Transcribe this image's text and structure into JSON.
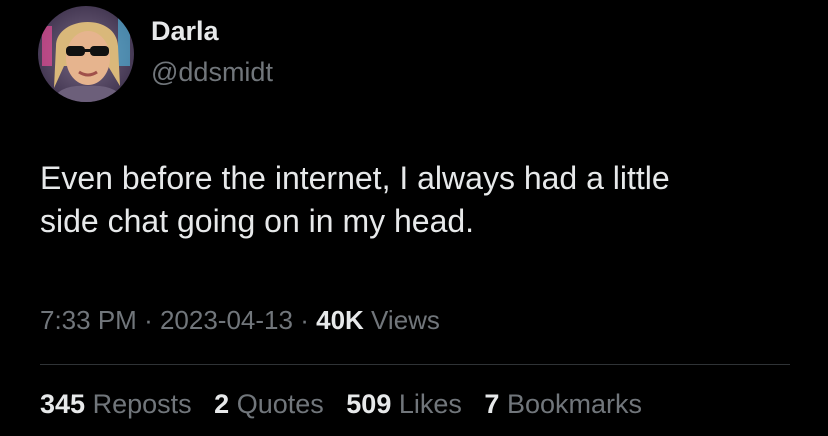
{
  "user": {
    "display_name": "Darla",
    "handle": "@ddsmidt",
    "avatar_icon": "profile-photo"
  },
  "tweet": {
    "lines": [
      "Even before the internet, I always had a little",
      "side chat going on in my head."
    ]
  },
  "meta": {
    "time": "7:33 PM",
    "separator": "·",
    "date": "2023-04-13",
    "views_count": "40K",
    "views_label": "Views"
  },
  "stats": {
    "reposts_count": "345",
    "reposts_label": "Reposts",
    "quotes_count": "2",
    "quotes_label": "Quotes",
    "likes_count": "509",
    "likes_label": "Likes",
    "bookmarks_count": "7",
    "bookmarks_label": "Bookmarks"
  },
  "colors": {
    "background": "#000000",
    "primary_text": "#e7e9ea",
    "secondary_text": "#71767b",
    "divider": "#2f3336"
  }
}
